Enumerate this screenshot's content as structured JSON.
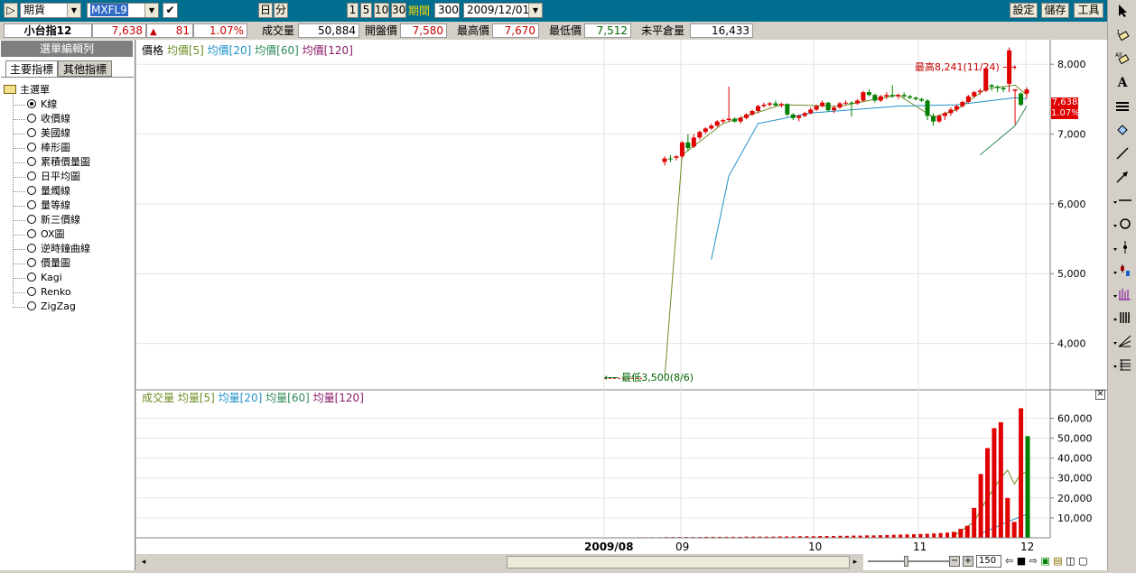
{
  "toolbar": {
    "market": "期貨",
    "symbol": "MXFL9",
    "day_button": "日",
    "minute_button": "分",
    "periods": [
      "1",
      "5",
      "10",
      "30"
    ],
    "period_label": "期間",
    "period_value": "300",
    "date_value": "2009/12/01",
    "settings_button": "設定",
    "save_button": "儲存",
    "tools_button": "工具"
  },
  "quote": {
    "name": "小台指12",
    "price": "7,638",
    "change": "81",
    "change_pct": "1.07%",
    "volume_label": "成交量",
    "volume": "50,884",
    "open_label": "開盤價",
    "open": "7,580",
    "high_label": "最高價",
    "high": "7,670",
    "low_label": "最低價",
    "low": "7,512",
    "oi_label": "未平倉量",
    "oi": "16,433"
  },
  "left_panel": {
    "title": "選單編輯列",
    "tabs": [
      "主要指標",
      "其他指標"
    ],
    "root": "主選單",
    "items": [
      "K線",
      "收價線",
      "美國線",
      "棒形圖",
      "累積價量圖",
      "日平均圖",
      "量燭線",
      "量等線",
      "新三價線",
      "OX圖",
      "逆時鐘曲線",
      "價量圖",
      "Kagi",
      "Renko",
      "ZigZag"
    ],
    "selected_index": 0
  },
  "price_legend": {
    "label": "價格",
    "ma5": "均價[5]",
    "ma20": "均價[20]",
    "ma60": "均價[60]",
    "ma120": "均價[120]"
  },
  "volume_legend": {
    "label": "成交量",
    "ma5": "均量[5]",
    "ma20": "均量[20]",
    "ma60": "均量[60]",
    "ma120": "均量[120]"
  },
  "annotations": {
    "high": "最高8,241(11/24)",
    "low": "最低3,500(8/6)",
    "last_price": "7,638",
    "last_pct": "1.07%"
  },
  "bottom": {
    "zoom_value": "150"
  },
  "colors": {
    "up": "#e00000",
    "down": "#008000",
    "ma5": "#6b8e23",
    "ma20": "#1e90c8",
    "ma60": "#2e8b57",
    "ma120": "#8b1a6b",
    "toolbar_bg": "#006f8f"
  },
  "chart_data": [
    {
      "type": "candlestick",
      "title": "價格",
      "y_ticks": [
        "8,000",
        "7,000",
        "6,000",
        "5,000",
        "4,000"
      ],
      "ylim": [
        3400,
        8300
      ],
      "x_ticks": [
        "2009/08",
        "09",
        "10",
        "11",
        "12"
      ],
      "series": [
        {
          "name": "均價[5]"
        },
        {
          "name": "均價[20]"
        },
        {
          "name": "均價[60]"
        },
        {
          "name": "均價[120]"
        }
      ],
      "candles": [
        {
          "o": 6600,
          "h": 6680,
          "l": 6550,
          "c": 6650
        },
        {
          "o": 6650,
          "h": 6700,
          "l": 6600,
          "c": 6640
        },
        {
          "o": 6660,
          "h": 6700,
          "l": 6620,
          "c": 6680
        },
        {
          "o": 6680,
          "h": 6900,
          "l": 6650,
          "c": 6880
        },
        {
          "o": 6880,
          "h": 7000,
          "l": 6760,
          "c": 6800
        },
        {
          "o": 6820,
          "h": 7000,
          "l": 6800,
          "c": 6950
        },
        {
          "o": 6950,
          "h": 7050,
          "l": 6920,
          "c": 7030
        },
        {
          "o": 7030,
          "h": 7100,
          "l": 7000,
          "c": 7080
        },
        {
          "o": 7080,
          "h": 7150,
          "l": 7060,
          "c": 7120
        },
        {
          "o": 7120,
          "h": 7200,
          "l": 7100,
          "c": 7180
        },
        {
          "o": 7180,
          "h": 7220,
          "l": 7150,
          "c": 7200
        },
        {
          "o": 7200,
          "h": 7680,
          "l": 7180,
          "c": 7220
        },
        {
          "o": 7220,
          "h": 7240,
          "l": 7160,
          "c": 7180
        },
        {
          "o": 7180,
          "h": 7260,
          "l": 7150,
          "c": 7230
        },
        {
          "o": 7230,
          "h": 7300,
          "l": 7210,
          "c": 7280
        },
        {
          "o": 7280,
          "h": 7350,
          "l": 7260,
          "c": 7330
        },
        {
          "o": 7330,
          "h": 7420,
          "l": 7300,
          "c": 7400
        },
        {
          "o": 7400,
          "h": 7450,
          "l": 7380,
          "c": 7420
        },
        {
          "o": 7420,
          "h": 7460,
          "l": 7390,
          "c": 7440
        },
        {
          "o": 7440,
          "h": 7480,
          "l": 7400,
          "c": 7410
        },
        {
          "o": 7410,
          "h": 7450,
          "l": 7380,
          "c": 7430
        },
        {
          "o": 7430,
          "h": 7440,
          "l": 7250,
          "c": 7280
        },
        {
          "o": 7280,
          "h": 7300,
          "l": 7200,
          "c": 7230
        },
        {
          "o": 7230,
          "h": 7280,
          "l": 7180,
          "c": 7260
        },
        {
          "o": 7260,
          "h": 7320,
          "l": 7240,
          "c": 7300
        },
        {
          "o": 7300,
          "h": 7380,
          "l": 7280,
          "c": 7350
        },
        {
          "o": 7350,
          "h": 7420,
          "l": 7330,
          "c": 7400
        },
        {
          "o": 7400,
          "h": 7480,
          "l": 7380,
          "c": 7450
        },
        {
          "o": 7450,
          "h": 7460,
          "l": 7320,
          "c": 7340
        },
        {
          "o": 7340,
          "h": 7400,
          "l": 7300,
          "c": 7380
        },
        {
          "o": 7380,
          "h": 7460,
          "l": 7360,
          "c": 7440
        },
        {
          "o": 7440,
          "h": 7480,
          "l": 7410,
          "c": 7450
        },
        {
          "o": 7450,
          "h": 7470,
          "l": 7250,
          "c": 7440
        },
        {
          "o": 7440,
          "h": 7500,
          "l": 7420,
          "c": 7480
        },
        {
          "o": 7480,
          "h": 7620,
          "l": 7460,
          "c": 7600
        },
        {
          "o": 7600,
          "h": 7640,
          "l": 7540,
          "c": 7560
        },
        {
          "o": 7560,
          "h": 7580,
          "l": 7450,
          "c": 7480
        },
        {
          "o": 7480,
          "h": 7560,
          "l": 7460,
          "c": 7540
        },
        {
          "o": 7540,
          "h": 7600,
          "l": 7500,
          "c": 7560
        },
        {
          "o": 7560,
          "h": 7700,
          "l": 7520,
          "c": 7540
        },
        {
          "o": 7540,
          "h": 7580,
          "l": 7500,
          "c": 7560
        },
        {
          "o": 7560,
          "h": 7600,
          "l": 7520,
          "c": 7540
        },
        {
          "o": 7540,
          "h": 7560,
          "l": 7500,
          "c": 7520
        },
        {
          "o": 7520,
          "h": 7540,
          "l": 7480,
          "c": 7500
        },
        {
          "o": 7500,
          "h": 7520,
          "l": 7460,
          "c": 7480
        },
        {
          "o": 7480,
          "h": 7500,
          "l": 7200,
          "c": 7260
        },
        {
          "o": 7260,
          "h": 7300,
          "l": 7120,
          "c": 7180
        },
        {
          "o": 7180,
          "h": 7280,
          "l": 7160,
          "c": 7260
        },
        {
          "o": 7260,
          "h": 7320,
          "l": 7200,
          "c": 7300
        },
        {
          "o": 7300,
          "h": 7380,
          "l": 7260,
          "c": 7350
        },
        {
          "o": 7350,
          "h": 7420,
          "l": 7320,
          "c": 7400
        },
        {
          "o": 7400,
          "h": 7480,
          "l": 7380,
          "c": 7460
        },
        {
          "o": 7460,
          "h": 7560,
          "l": 7440,
          "c": 7540
        },
        {
          "o": 7540,
          "h": 7620,
          "l": 7520,
          "c": 7600
        },
        {
          "o": 7600,
          "h": 7650,
          "l": 7560,
          "c": 7620
        },
        {
          "o": 7620,
          "h": 7960,
          "l": 7600,
          "c": 7940
        },
        {
          "o": 7700,
          "h": 7720,
          "l": 7620,
          "c": 7680
        },
        {
          "o": 7680,
          "h": 7700,
          "l": 7600,
          "c": 7660
        },
        {
          "o": 7660,
          "h": 7680,
          "l": 7600,
          "c": 7640
        },
        {
          "o": 7720,
          "h": 8241,
          "l": 7600,
          "c": 8200
        },
        {
          "o": 7620,
          "h": 7640,
          "l": 7140,
          "c": 7640
        },
        {
          "o": 7580,
          "h": 7600,
          "l": 7400,
          "c": 7420
        },
        {
          "o": 7580,
          "h": 7670,
          "l": 7512,
          "c": 7638
        }
      ],
      "ma5": [
        [
          0,
          3500
        ],
        [
          3,
          6700
        ],
        [
          10,
          7150
        ],
        [
          20,
          7420
        ],
        [
          30,
          7400
        ],
        [
          40,
          7560
        ],
        [
          46,
          7240
        ],
        [
          50,
          7350
        ],
        [
          55,
          7650
        ],
        [
          60,
          7700
        ],
        [
          62,
          7560
        ]
      ],
      "ma20": [
        [
          8,
          5200
        ],
        [
          11,
          6400
        ],
        [
          16,
          7150
        ],
        [
          25,
          7300
        ],
        [
          40,
          7400
        ],
        [
          50,
          7420
        ],
        [
          60,
          7520
        ],
        [
          62,
          7500
        ]
      ],
      "ma60": [
        [
          54,
          6700
        ],
        [
          60,
          7120
        ],
        [
          62,
          7400
        ]
      ],
      "low_label": {
        "price": 3500,
        "date": "8/6"
      },
      "high_label": {
        "price": 8241,
        "date": "11/24"
      }
    },
    {
      "type": "bar",
      "title": "成交量",
      "y_ticks": [
        "60,000",
        "50,000",
        "40,000",
        "30,000",
        "20,000",
        "10,000"
      ],
      "ylim": [
        0,
        67000
      ],
      "values": [
        200,
        200,
        200,
        200,
        200,
        300,
        300,
        300,
        300,
        400,
        400,
        400,
        400,
        400,
        400,
        500,
        500,
        500,
        500,
        500,
        500,
        600,
        600,
        600,
        600,
        600,
        700,
        700,
        700,
        800,
        800,
        800,
        900,
        900,
        900,
        1000,
        1000,
        1100,
        1100,
        1200,
        1200,
        1300,
        1400,
        1500,
        1600,
        1700,
        1800,
        1900,
        2000,
        2200,
        2400,
        2600,
        3000,
        4500,
        6000,
        15000,
        32000,
        45000,
        55000,
        58000,
        20000,
        8000,
        65000,
        51000
      ],
      "ma5": [
        [
          52,
          1000
        ],
        [
          55,
          8000
        ],
        [
          57,
          20000
        ],
        [
          59,
          30000
        ],
        [
          60,
          34000
        ],
        [
          61,
          27000
        ],
        [
          62,
          32000
        ],
        [
          63,
          33000
        ]
      ],
      "ma20": [
        [
          56,
          2000
        ],
        [
          60,
          8000
        ],
        [
          63,
          12000
        ]
      ]
    }
  ]
}
